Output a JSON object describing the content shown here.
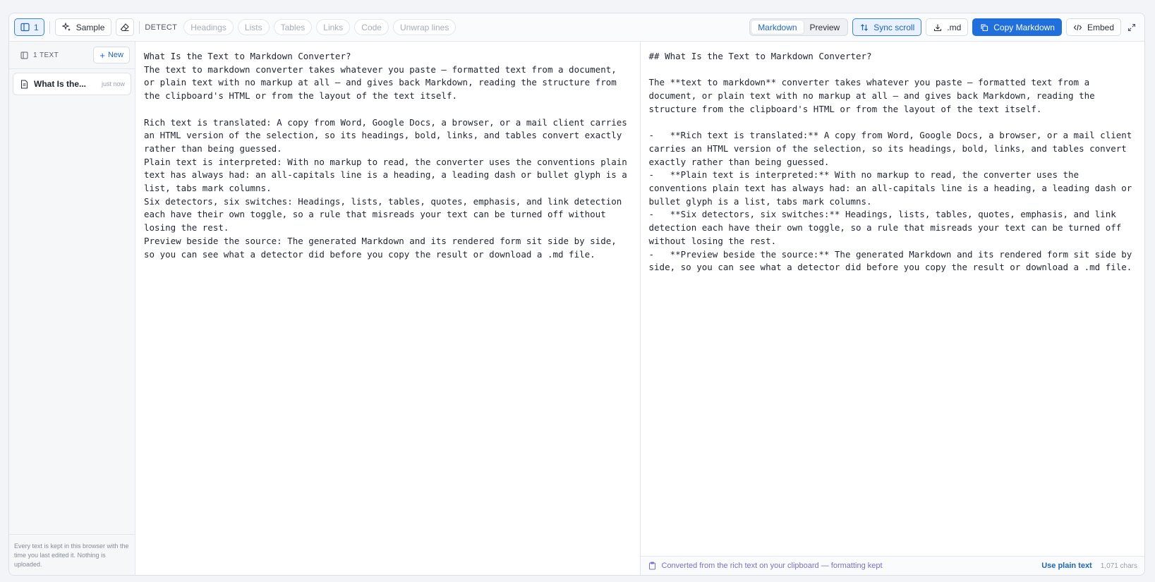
{
  "toolbar": {
    "sidebar_toggle_count": "1",
    "sample_label": "Sample",
    "detect_label": "DETECT",
    "detectors": [
      "Headings",
      "Lists",
      "Tables",
      "Links",
      "Code",
      "Unwrap lines"
    ],
    "view_modes": [
      "Markdown",
      "Preview"
    ],
    "sync_scroll_label": "Sync scroll",
    "download_label": ".md",
    "copy_label": "Copy Markdown",
    "embed_label": "Embed"
  },
  "sidebar": {
    "count_label": "1 TEXT",
    "new_label": "New",
    "items": [
      {
        "title": "What Is the...",
        "time": "just now"
      }
    ],
    "footer": "Every text is kept in this browser with the time you last edited it. Nothing is uploaded."
  },
  "source": {
    "lines": [
      "What Is the Text to Markdown Converter?",
      "The text to markdown converter takes whatever you paste — formatted text from a document, or plain text with no markup at all — and gives back Markdown, reading the structure from the clipboard's HTML or from the layout of the text itself.",
      "",
      "Rich text is translated: A copy from Word, Google Docs, a browser, or a mail client carries an HTML version of the selection, so its headings, bold, links, and tables convert exactly rather than being guessed.",
      "Plain text is interpreted: With no markup to read, the converter uses the conventions plain text has always had: an all-capitals line is a heading, a leading dash or bullet glyph is a list, tabs mark columns.",
      "Six detectors, six switches: Headings, lists, tables, quotes, emphasis, and link detection each have their own toggle, so a rule that misreads your text can be turned off without losing the rest.",
      "Preview beside the source: The generated Markdown and its rendered form sit side by side, so you can see what a detector did before you copy the result or download a .md file."
    ]
  },
  "output": {
    "lines": [
      "## What Is the Text to Markdown Converter?",
      "",
      "The **text to markdown** converter takes whatever you paste — formatted text from a document, or plain text with no markup at all — and gives back Markdown, reading the structure from the clipboard's HTML or from the layout of the text itself.",
      "",
      "-   **Rich text is translated:** A copy from Word, Google Docs, a browser, or a mail client carries an HTML version of the selection, so its headings, bold, links, and tables convert exactly rather than being guessed.",
      "-   **Plain text is interpreted:** With no markup to read, the converter uses the conventions plain text has always had: an all-capitals line is a heading, a leading dash or bullet glyph is a list, tabs mark columns.",
      "-   **Six detectors, six switches:** Headings, lists, tables, quotes, emphasis, and link detection each have their own toggle, so a rule that misreads your text can be turned off without losing the rest.",
      "-   **Preview beside the source:** The generated Markdown and its rendered form sit side by side, so you can see what a detector did before you copy the result or download a .md file."
    ],
    "footer_note": "Converted from the rich text on your clipboard — formatting kept",
    "footer_action": "Use plain text",
    "char_count": "1,071 chars"
  },
  "colors": {
    "accent": "#1f6fdc",
    "note": "#7a6fcf"
  }
}
